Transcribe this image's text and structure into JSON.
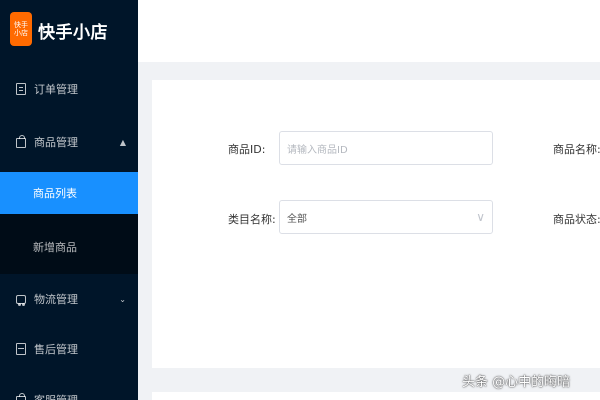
{
  "app": {
    "logo_text": "快手小店",
    "logo_icon": "kuaishou-logo-icon"
  },
  "sidebar": {
    "items": [
      {
        "label": "订单管理",
        "icon": "order-doc-icon"
      },
      {
        "label": "商品管理",
        "icon": "product-bag-icon",
        "arrow": "^"
      },
      {
        "label": "物流管理",
        "icon": "logistics-truck-icon",
        "arrow": "v"
      },
      {
        "label": "售后管理",
        "icon": "after-sales-icon"
      },
      {
        "label": "客服管理",
        "icon": "customer-service-icon",
        "arrow": "v"
      }
    ],
    "submenu": [
      {
        "label": "商品列表",
        "active": true
      },
      {
        "label": "新增商品",
        "active": false
      }
    ]
  },
  "filter": {
    "product_id_label": "商品ID:",
    "product_id_placeholder": "请输入商品ID",
    "product_name_label": "商品名称:",
    "category_label": "类目名称:",
    "category_value": "全部",
    "category_arrow": "∨",
    "status_label": "商品状态:"
  },
  "watermark": "头条 @心中的晦暗",
  "colors": {
    "sidebar_bg": "#001529",
    "submenu_bg": "#000c17",
    "active": "#1890ff",
    "logo": "#ff6a00"
  }
}
